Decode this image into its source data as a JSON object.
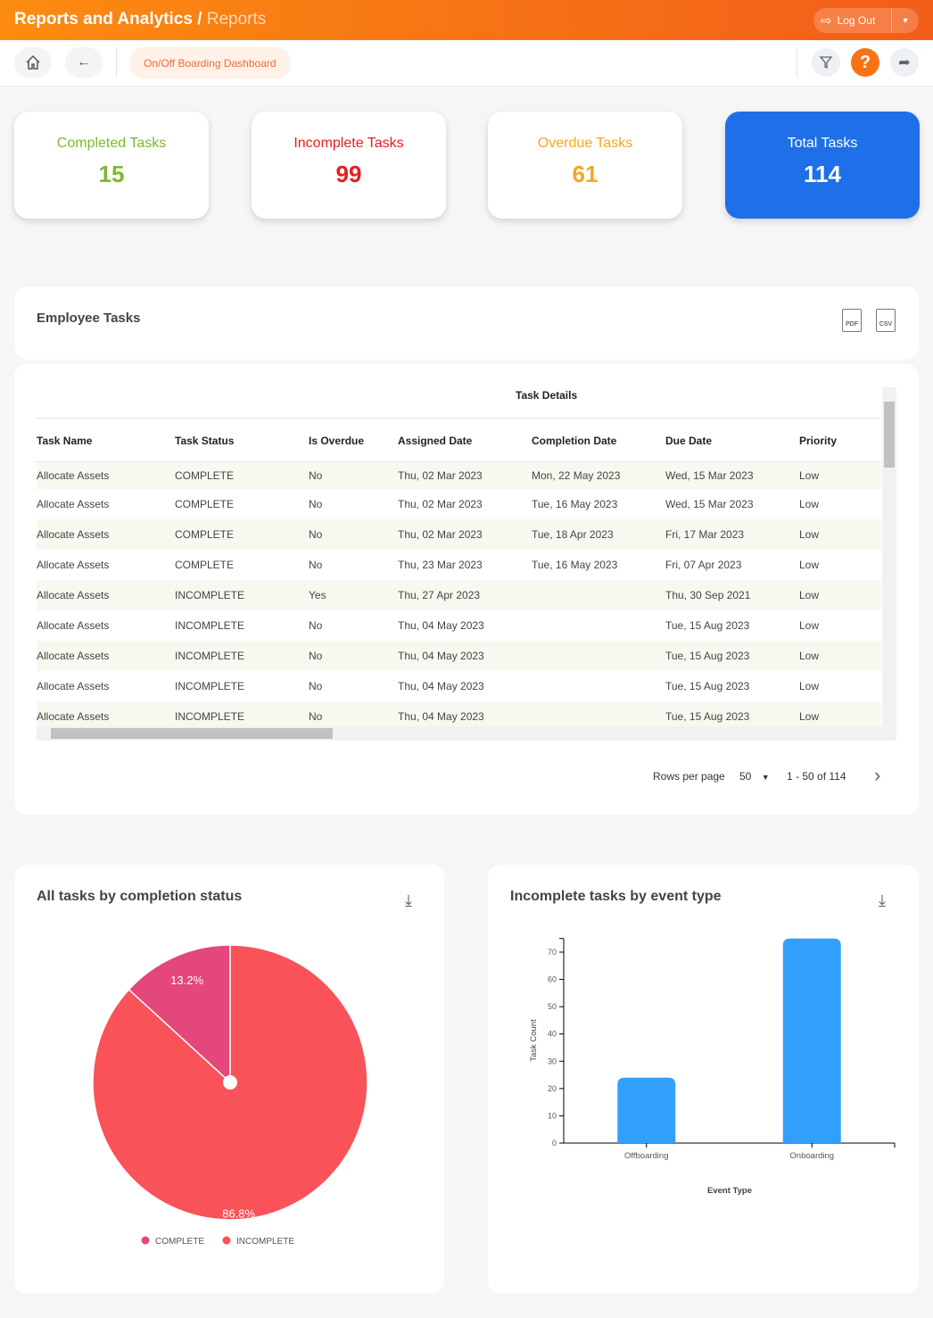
{
  "header": {
    "title": "Reports and Analytics",
    "separator": "/",
    "subtitle": "Reports",
    "logout_label": "Log Out"
  },
  "toolbar": {
    "breadcrumb": "On/Off Boarding Dashboard"
  },
  "colors": {
    "accent": "#f97316",
    "complete": "#7cb82f",
    "incomplete": "#e3201b",
    "overdue": "#f5a623",
    "total": "#1f6fe8",
    "pie_complete": "#e3477b",
    "pie_incomplete": "#f95258",
    "bar": "#339ffd"
  },
  "cards": [
    {
      "label": "Completed Tasks",
      "value": "15"
    },
    {
      "label": "Incomplete Tasks",
      "value": "99"
    },
    {
      "label": "Overdue Tasks",
      "value": "61"
    },
    {
      "label": "Total Tasks",
      "value": "114"
    }
  ],
  "employee_tasks": {
    "title": "Employee Tasks",
    "pdf": "PDF",
    "csv": "CSV"
  },
  "table": {
    "group_header": "Task Details",
    "columns": [
      "Task Name",
      "Task Status",
      "Is Overdue",
      "Assigned Date",
      "Completion Date",
      "Due Date",
      "Priority"
    ],
    "rows": [
      [
        "Allocate Assets",
        "COMPLETE",
        "No",
        "Thu, 02 Mar 2023",
        "Mon, 22 May 2023",
        "Wed, 15 Mar 2023",
        "Low"
      ],
      [
        "Allocate Assets",
        "COMPLETE",
        "No",
        "Thu, 02 Mar 2023",
        "Tue, 16 May 2023",
        "Wed, 15 Mar 2023",
        "Low"
      ],
      [
        "Allocate Assets",
        "COMPLETE",
        "No",
        "Thu, 02 Mar 2023",
        "Tue, 18 Apr 2023",
        "Fri, 17 Mar 2023",
        "Low"
      ],
      [
        "Allocate Assets",
        "COMPLETE",
        "No",
        "Thu, 23 Mar 2023",
        "Tue, 16 May 2023",
        "Fri, 07 Apr 2023",
        "Low"
      ],
      [
        "Allocate Assets",
        "INCOMPLETE",
        "Yes",
        "Thu, 27 Apr 2023",
        "",
        "Thu, 30 Sep 2021",
        "Low"
      ],
      [
        "Allocate Assets",
        "INCOMPLETE",
        "No",
        "Thu, 04 May 2023",
        "",
        "Tue, 15 Aug 2023",
        "Low"
      ],
      [
        "Allocate Assets",
        "INCOMPLETE",
        "No",
        "Thu, 04 May 2023",
        "",
        "Tue, 15 Aug 2023",
        "Low"
      ],
      [
        "Allocate Assets",
        "INCOMPLETE",
        "No",
        "Thu, 04 May 2023",
        "",
        "Tue, 15 Aug 2023",
        "Low"
      ],
      [
        "Allocate Assets",
        "INCOMPLETE",
        "No",
        "Thu, 04 May 2023",
        "",
        "Tue, 15 Aug 2023",
        "Low"
      ]
    ],
    "rows_per_page_label": "Rows per page",
    "rows_per_page": "50",
    "range": "1 - 50 of 114"
  },
  "chart_data": [
    {
      "type": "pie",
      "title": "All tasks by completion status",
      "categories": [
        "COMPLETE",
        "INCOMPLETE"
      ],
      "values": [
        13.2,
        86.8
      ],
      "labels": [
        "13.2%",
        "86.8%"
      ],
      "legend": "bottom"
    },
    {
      "type": "bar",
      "title": "Incomplete tasks by event type",
      "categories": [
        "Offboarding",
        "Onboarding"
      ],
      "values": [
        24,
        75
      ],
      "xlabel": "Event Type",
      "ylabel": "Task Count",
      "ylim": [
        0,
        75
      ],
      "yticks": [
        "0",
        "10",
        "20",
        "30",
        "40",
        "50",
        "60",
        "70"
      ],
      "grid": false
    }
  ]
}
